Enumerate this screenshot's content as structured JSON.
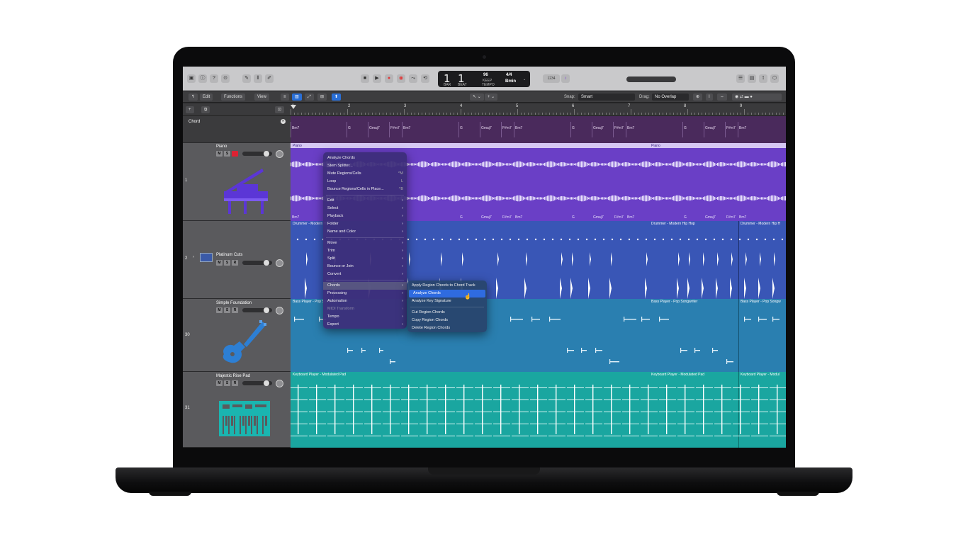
{
  "lcd": {
    "bar": "1",
    "beat": "1",
    "tempo": "96",
    "tempo_mode": "KEEP",
    "time_sig": "4/4",
    "key": "Bmin",
    "bar_label": "BAR",
    "beat_label": "BEAT",
    "tempo_label": "TEMPO"
  },
  "titlebar_extra": "1234",
  "toolbar": {
    "edit": "Edit",
    "functions": "Functions",
    "view": "View",
    "snap_label": "Snap:",
    "snap_value": "Smart",
    "drag_label": "Drag:",
    "drag_value": "No Overlap"
  },
  "ruler": [
    "1",
    "2",
    "3",
    "4",
    "5",
    "6",
    "7",
    "8",
    "9"
  ],
  "chord_track": {
    "name": "Chord",
    "chords": [
      "Bm7",
      "G",
      "Gmaj7",
      "F#m7",
      "Bm7",
      "G",
      "Gmaj7",
      "F#m7",
      "Bm7",
      "G",
      "Gmaj7",
      "F#m7",
      "Bm7",
      "G",
      "Gmaj7",
      "F#m7",
      "Bm7"
    ]
  },
  "tracks": [
    {
      "num": "1",
      "name": "Piano",
      "region": "Piano",
      "region2": "Piano"
    },
    {
      "num": "2",
      "name": "Platinum Cuts",
      "region": "Drummer - Modern Hip Hop",
      "region2": "Drummer - Modern Hip Hop",
      "region3": "Drummer - Modern Hip H"
    },
    {
      "num": "30",
      "name": "Simple Foundation",
      "region": "Bass Player - Pop Songwriter",
      "region2": "Bass Player - Pop Songwriter",
      "region3": "Bass Player - Pop Songw"
    },
    {
      "num": "31",
      "name": "Majestic Rise Pad",
      "region": "Keyboard Player - Modulated Pad",
      "region2": "Keyboard Player - Modulated Pad",
      "region3": "Keyboard Player - Modul"
    }
  ],
  "piano_bottom_chords": [
    "Bm7",
    "G",
    "Gmaj7",
    "F#m7",
    "Bm7",
    "G",
    "Gmaj7",
    "F#m7",
    "Bm7",
    "G",
    "Gmaj7",
    "F#m7",
    "Bm7"
  ],
  "msr": {
    "m": "M",
    "s": "S",
    "r": "R"
  },
  "menu": {
    "items": [
      "Analyze Chords",
      "Stem Splitter...",
      "Mute Regions/Cells",
      "Loop",
      "Bounce Regions/Cells in Place...",
      "Edit",
      "Select",
      "Playback",
      "Folder",
      "Name and Color",
      "Move",
      "Trim",
      "Split",
      "Bounce or Join",
      "Convert",
      "Chords",
      "Processing",
      "Automation",
      "MIDI Transform",
      "Tempo",
      "Export"
    ],
    "mute_shortcut": "^M",
    "loop_shortcut": "L",
    "bounce_shortcut": "^B"
  },
  "submenu": {
    "items": [
      "Apply Region Chords to Chord Track",
      "Analyze Chords",
      "Analyze Key Signature",
      "Cut Region Chords",
      "Copy Region Chords",
      "Delete Region Chords"
    ]
  }
}
